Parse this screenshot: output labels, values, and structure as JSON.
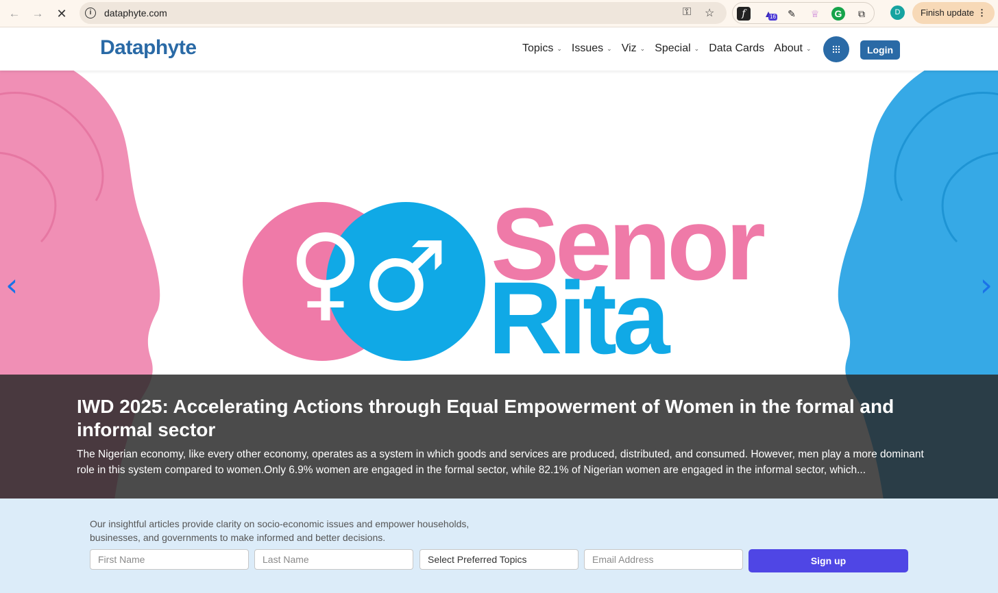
{
  "browser": {
    "url": "dataphyte.com",
    "extension_badge": "16",
    "profile_initial": "D",
    "finish_update_label": "Finish update"
  },
  "header": {
    "logo": "Dataphyte",
    "menu": [
      {
        "label": "Topics",
        "has_dropdown": true
      },
      {
        "label": "Issues",
        "has_dropdown": true
      },
      {
        "label": "Viz",
        "has_dropdown": true
      },
      {
        "label": "Special",
        "has_dropdown": true
      },
      {
        "label": "Data Cards",
        "has_dropdown": false
      },
      {
        "label": "About",
        "has_dropdown": true
      }
    ],
    "login_label": "Login"
  },
  "hero": {
    "image_words": [
      "Senor",
      "Rita"
    ],
    "title": "IWD 2025: Accelerating Actions through Equal Empowerment of Women in the formal and informal sector",
    "excerpt": "The Nigerian economy, like every other economy, operates as a system in which goods and services are produced, distributed, and consumed. However, men play a more dominant role in this system compared to women.Only 6.9% women are engaged in the formal sector, while 82.1% of Nigerian women are engaged in the informal sector, which..."
  },
  "newsletter": {
    "description": "Our insightful articles provide clarity on socio-economic issues and empower households, businesses, and governments to make informed and better decisions.",
    "first_name_placeholder": "First Name",
    "last_name_placeholder": "Last Name",
    "topics_select": "Select Preferred Topics",
    "email_placeholder": "Email Address",
    "signup_label": "Sign up"
  },
  "colors": {
    "brand_blue": "#2a6aa6",
    "pink": "#ef7aa8",
    "cyan": "#10a9e6",
    "signup_purple": "#4f46e5"
  }
}
